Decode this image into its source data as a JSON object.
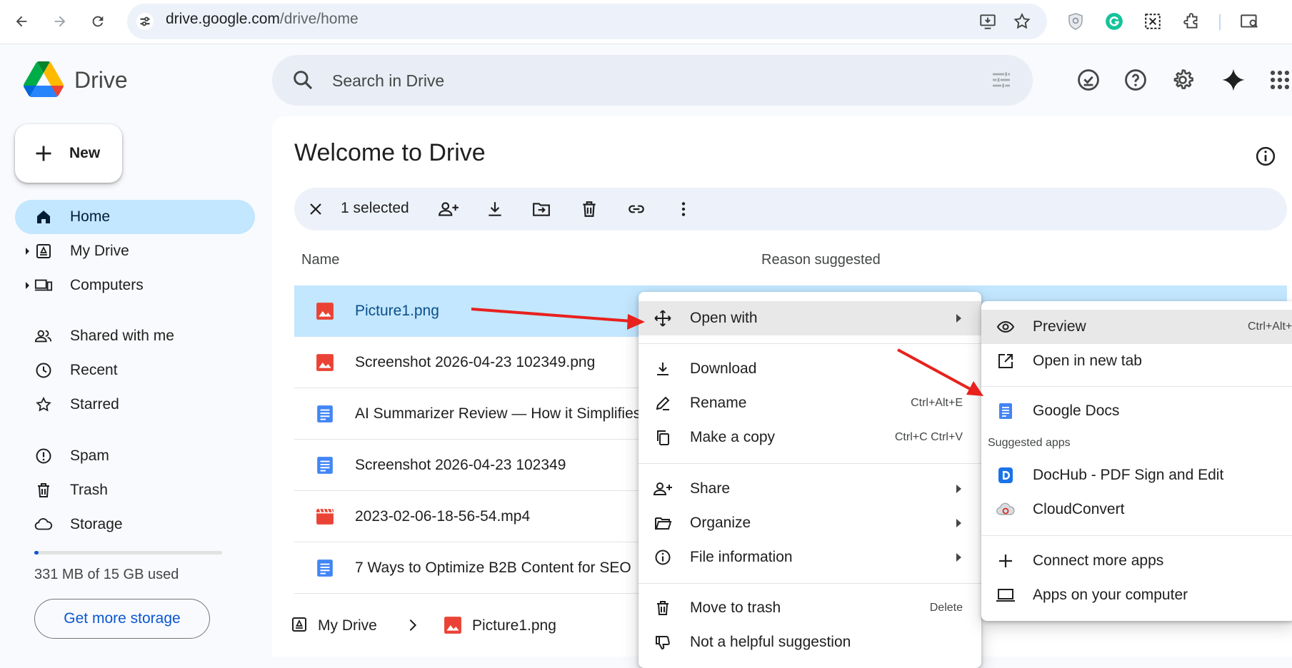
{
  "browser": {
    "url_host": "drive.google.com",
    "url_path": "/drive/home"
  },
  "header": {
    "app_name": "Drive",
    "search_placeholder": "Search in Drive"
  },
  "sidebar": {
    "new_label": "New",
    "items": [
      {
        "label": "Home",
        "icon": "home-icon",
        "active": true
      },
      {
        "label": "My Drive",
        "icon": "my-drive-icon"
      },
      {
        "label": "Computers",
        "icon": "computers-icon"
      },
      {
        "label": "Shared with me",
        "icon": "people-icon"
      },
      {
        "label": "Recent",
        "icon": "clock-icon"
      },
      {
        "label": "Starred",
        "icon": "star-icon"
      },
      {
        "label": "Spam",
        "icon": "spam-icon"
      },
      {
        "label": "Trash",
        "icon": "trash-icon"
      },
      {
        "label": "Storage",
        "icon": "cloud-icon"
      }
    ],
    "storage_text": "331 MB of 15 GB used",
    "storage_fraction": 0.022,
    "storage_button": "Get more storage"
  },
  "main": {
    "title": "Welcome to Drive",
    "selection": {
      "count_label": "1 selected"
    },
    "columns": {
      "name": "Name",
      "reason": "Reason suggested"
    },
    "files": [
      {
        "name": "Picture1.png",
        "type": "image",
        "selected": true
      },
      {
        "name": "Screenshot 2026-04-23 102349.png",
        "type": "image"
      },
      {
        "name": "AI Summarizer Review — How it Simplifies",
        "type": "doc"
      },
      {
        "name": "Screenshot 2026-04-23 102349",
        "type": "doc"
      },
      {
        "name": "2023-02-06-18-56-54.mp4",
        "type": "video"
      },
      {
        "name": "7 Ways to Optimize B2B Content for SEO",
        "type": "doc"
      }
    ],
    "breadcrumb": {
      "root": "My Drive",
      "file": "Picture1.png"
    }
  },
  "context_menu": {
    "open_with": "Open with",
    "download": "Download",
    "rename": "Rename",
    "rename_shortcut": "Ctrl+Alt+E",
    "make_copy": "Make a copy",
    "make_copy_shortcut": "Ctrl+C Ctrl+V",
    "share": "Share",
    "organize": "Organize",
    "file_information": "File information",
    "move_to_trash": "Move to trash",
    "move_to_trash_shortcut": "Delete",
    "not_helpful": "Not a helpful suggestion"
  },
  "submenu": {
    "preview": "Preview",
    "preview_shortcut": "Ctrl+Alt+",
    "open_new_tab": "Open in new tab",
    "google_docs": "Google Docs",
    "suggested_apps_header": "Suggested apps",
    "dochub": "DocHub - PDF Sign and Edit",
    "cloudconvert": "CloudConvert",
    "connect_more": "Connect more apps",
    "apps_on_computer": "Apps on your computer"
  },
  "colors": {
    "accent": "#0b57d0",
    "selected_bg": "#c2e7ff",
    "annotation_arrow": "#e8211d"
  }
}
